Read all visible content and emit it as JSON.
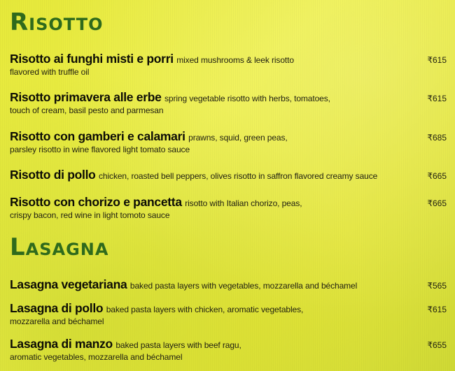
{
  "sections": [
    {
      "title": "Risotto",
      "items": [
        {
          "name": "Risotto ai funghi misti e porri",
          "desc": "mixed mushrooms & leek risotto",
          "desc2": "flavored with truffle oil",
          "price": "₹615"
        },
        {
          "name": "Risotto primavera alle erbe",
          "desc": "spring vegetable risotto with herbs, tomatoes,",
          "desc2": "touch of cream, basil pesto and parmesan",
          "price": "₹615"
        },
        {
          "name": "Risotto con gamberi e calamari",
          "desc": "prawns, squid, green peas,",
          "desc2": "parsley risotto in wine flavored light tomato sauce",
          "price": "₹685"
        },
        {
          "name": "Risotto di pollo",
          "desc": "chicken, roasted bell peppers, olives risotto in saffron flavored creamy sauce",
          "price": "₹665"
        },
        {
          "name": "Risotto con chorizo e pancetta",
          "desc": "risotto with Italian chorizo, peas,",
          "desc2": "crispy bacon, red wine in light tomoto sauce",
          "price": "₹665"
        }
      ]
    },
    {
      "title": "Lasagna",
      "items": [
        {
          "name": "Lasagna vegetariana",
          "desc": "baked pasta layers with vegetables, mozzarella and béchamel",
          "price": "₹565"
        },
        {
          "name": "Lasagna di pollo",
          "desc": "baked pasta layers with chicken, aromatic vegetables,",
          "desc2": "mozzarella and béchamel",
          "price": "₹615"
        },
        {
          "name": "Lasagna di manzo",
          "desc": "baked pasta layers with beef ragu,",
          "desc2": "aromatic vegetables, mozzarella and béchamel",
          "price": "₹655"
        }
      ]
    }
  ]
}
